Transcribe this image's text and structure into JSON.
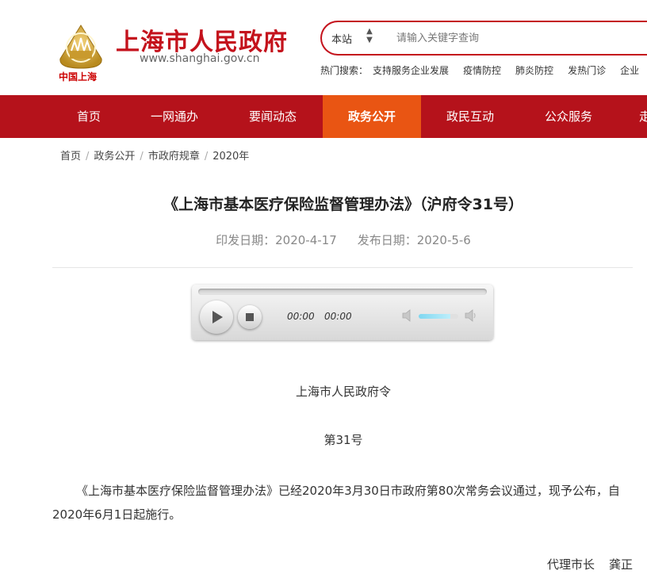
{
  "header": {
    "logo_caption": "中国上海",
    "site_title": "上海市人民政府",
    "site_url": "www.shanghai.gov.cn",
    "search": {
      "scope_label": "本站",
      "placeholder": "请输入关键字查询"
    },
    "hot_search": {
      "label": "热门搜索：",
      "items": [
        "支持服务企业发展",
        "疫情防控",
        "肺炎防控",
        "发热门诊",
        "企业"
      ]
    }
  },
  "nav": {
    "items": [
      "首页",
      "一网通办",
      "要闻动态",
      "政务公开",
      "政民互动",
      "公众服务",
      "走"
    ],
    "active_index": 3
  },
  "breadcrumb": [
    "首页",
    "政务公开",
    "市政府规章",
    "2020年"
  ],
  "article": {
    "title": "《上海市基本医疗保险监督管理办法》（沪府令31号）",
    "issue_date": "印发日期：2020-4-17",
    "publish_date": "发布日期：2020-5-6",
    "player": {
      "current_time": "00:00",
      "duration": "00:00",
      "volume": 0.8
    },
    "issuer": "上海市人民政府令",
    "number": "第31号",
    "paragraph": "《上海市基本医疗保险监督管理办法》已经2020年3月30日市政府第80次常务会议通过，现予公布，自2020年6月1日起施行。",
    "signature_role": "代理市长",
    "signature_name": "龚正"
  },
  "colors": {
    "brand_red": "#b5121b",
    "nav_active": "#e95513",
    "title_red": "#c4121c"
  }
}
